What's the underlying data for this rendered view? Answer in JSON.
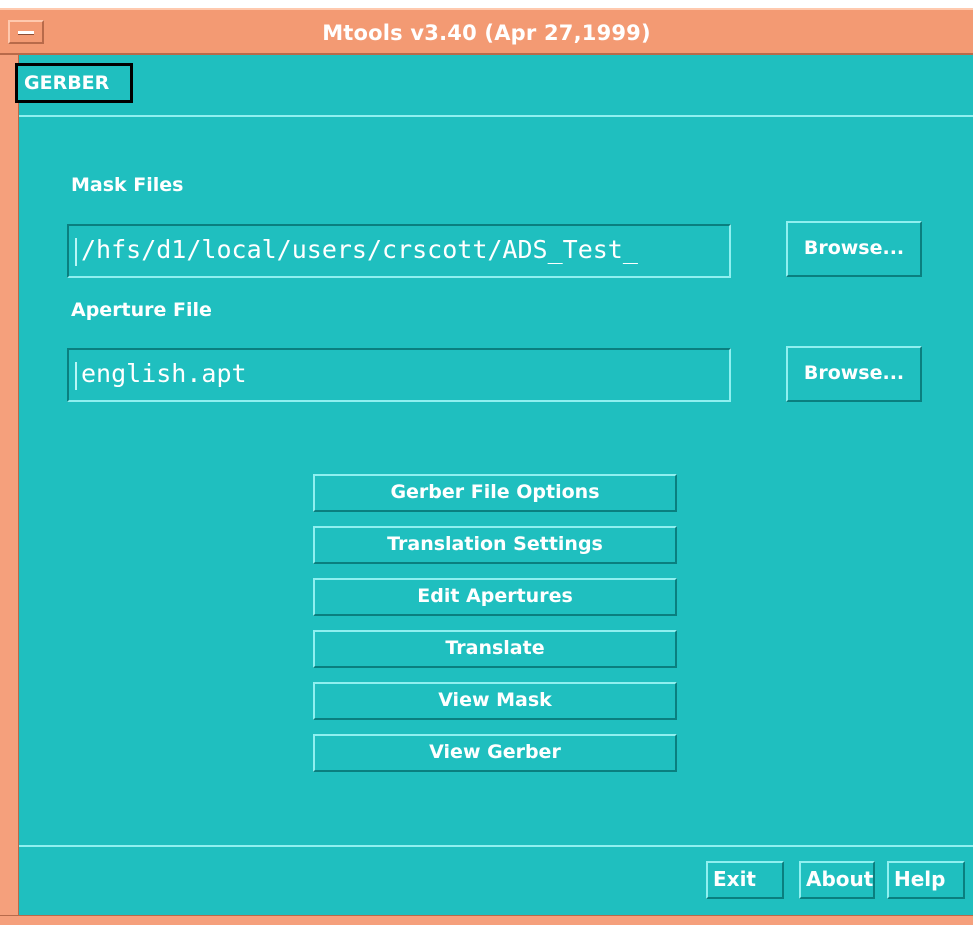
{
  "window": {
    "title": "Mtools v3.40 (Apr 27,1999)"
  },
  "tab": {
    "label": "GERBER"
  },
  "mask_files": {
    "label": "Mask Files",
    "value": "/hfs/d1/local/users/crscott/ADS_Test_",
    "browse_label": "Browse..."
  },
  "aperture_file": {
    "label": "Aperture File",
    "value": "english.apt",
    "browse_label": "Browse..."
  },
  "actions": {
    "gerber_file_options": "Gerber File Options",
    "translation_settings": "Translation Settings",
    "edit_apertures": "Edit Apertures",
    "translate": "Translate",
    "view_mask": "View Mask",
    "view_gerber": "View Gerber"
  },
  "footer": {
    "exit": "Exit",
    "about": "About",
    "help": "Help"
  },
  "colors": {
    "background": "#1fbfbf",
    "frame": "#f39a73",
    "text": "#ffffff"
  }
}
